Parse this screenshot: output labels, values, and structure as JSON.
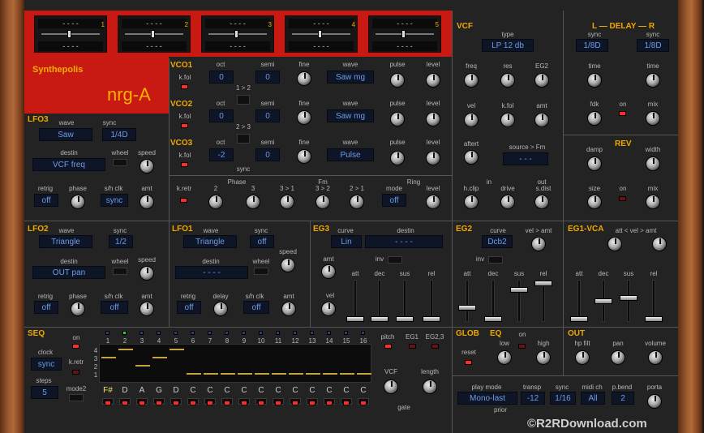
{
  "app": {
    "brand": "Synthepolis",
    "model": "nrg-A"
  },
  "macros": [
    {
      "num": "1",
      "val": "- - - -",
      "val2": "- - - -"
    },
    {
      "num": "2",
      "val": "- - - -",
      "val2": "- - - -"
    },
    {
      "num": "3",
      "val": "- - - -",
      "val2": "- - - -"
    },
    {
      "num": "4",
      "val": "- - - -",
      "val2": "- - - -"
    },
    {
      "num": "5",
      "val": "- - - -",
      "val2": "- - - -"
    }
  ],
  "vco1": {
    "title": "VCO1",
    "kfol": "k.fol",
    "oct_l": "oct",
    "oct": "0",
    "semi_l": "semi",
    "semi": "0",
    "fine": "fine",
    "wave_l": "wave",
    "wave": "Saw mg",
    "pulse": "pulse",
    "level": "level"
  },
  "vco2": {
    "title": "VCO2",
    "kfol": "k.fol",
    "oct_l": "oct",
    "oct": "0",
    "semi_l": "semi",
    "semi": "0",
    "fine": "fine",
    "wave_l": "wave",
    "wave": "Saw mg",
    "pulse": "pulse",
    "level": "level"
  },
  "vco3": {
    "title": "VCO3",
    "kfol": "k.fol",
    "oct_l": "oct",
    "oct": "-2",
    "semi_l": "semi",
    "semi": "0",
    "fine": "fine",
    "wave_l": "wave",
    "wave": "Pulse",
    "pulse": "pulse",
    "level": "level"
  },
  "sync": {
    "s12": "1 > 2",
    "s23": "2 > 3",
    "label": "sync"
  },
  "mix": {
    "kretr": "k.retr",
    "phase": "Phase",
    "p2": "2",
    "p3": "3",
    "fm": "Fm",
    "fm1": "3 > 1",
    "fm2": "3 > 2",
    "fm3": "2 > 1",
    "ring": "Ring",
    "mode_l": "mode",
    "mode": "off",
    "level": "level"
  },
  "vcf": {
    "title": "VCF",
    "type_l": "type",
    "type": "LP 12 db",
    "freq": "freq",
    "res": "res",
    "eg2": "EG2",
    "vel": "vel",
    "kfol": "k.fol",
    "amt": "amt",
    "aftert": "aftert",
    "src_l": "source > Fm",
    "src": "- - -",
    "in": "in",
    "out": "out",
    "hclip": "h.clip",
    "drive": "drive",
    "sdist": "s.dist"
  },
  "delay": {
    "title": "L — DELAY — R",
    "sync_l": "sync",
    "l": "1/8D",
    "r": "1/8D",
    "time": "time",
    "fdk": "fdk",
    "on": "on",
    "mix": "mix"
  },
  "rev": {
    "title": "REV",
    "damp": "damp",
    "width": "width",
    "size": "size",
    "on": "on",
    "mix": "mix"
  },
  "lfo3": {
    "title": "LFO3",
    "wave_l": "wave",
    "wave": "Saw",
    "sync_l": "sync",
    "sync": "1/4D",
    "speed": "speed",
    "destin_l": "destin",
    "destin": "VCF freq",
    "wheel": "wheel",
    "retrig_l": "retrig",
    "retrig": "off",
    "phase": "phase",
    "sh_l": "s/h clk",
    "sh": "sync",
    "amt": "amt"
  },
  "lfo2": {
    "title": "LFO2",
    "wave_l": "wave",
    "wave": "Triangle",
    "sync_l": "sync",
    "sync": "1/2",
    "speed": "speed",
    "destin_l": "destin",
    "destin": "OUT pan",
    "wheel": "wheel",
    "retrig_l": "retrig",
    "retrig": "off",
    "phase": "phase",
    "sh_l": "s/h clk",
    "sh": "off",
    "amt": "amt"
  },
  "lfo1": {
    "title": "LFO1",
    "wave_l": "wave",
    "wave": "Triangle",
    "sync_l": "sync",
    "sync": "off",
    "speed": "speed",
    "destin_l": "destin",
    "destin": "- - - -",
    "wheel": "wheel",
    "retrig_l": "retrig",
    "retrig": "off",
    "delay": "delay",
    "sh_l": "s/h clk",
    "sh": "off",
    "amt": "amt"
  },
  "eg3": {
    "title": "EG3",
    "curve_l": "curve",
    "curve": "Lin",
    "destin_l": "destin",
    "destin": "- - - -",
    "amt": "amt",
    "inv": "inv",
    "vel": "vel",
    "att": "att",
    "dec": "dec",
    "sus": "sus",
    "rel": "rel"
  },
  "eg2": {
    "title": "EG2",
    "curve_l": "curve",
    "curve": "Dcb2",
    "velamt": "vel > amt",
    "inv": "inv",
    "att": "att",
    "dec": "dec",
    "sus": "sus",
    "rel": "rel"
  },
  "eg1": {
    "title": "EG1-VCA",
    "attvel": "att < vel > amt",
    "att": "att",
    "dec": "dec",
    "sus": "sus",
    "rel": "rel"
  },
  "seq": {
    "title": "SEQ",
    "on": "on",
    "clock_l": "clock",
    "clock": "sync",
    "kretr": "k.retr",
    "steps_l": "steps",
    "steps": "5",
    "mode2": "mode2",
    "rows": [
      "4",
      "3",
      "2",
      "1"
    ],
    "nums": [
      "1",
      "2",
      "3",
      "4",
      "5",
      "6",
      "7",
      "8",
      "9",
      "10",
      "11",
      "12",
      "13",
      "14",
      "15",
      "16"
    ],
    "notes": [
      "F#",
      "D",
      "A",
      "G",
      "D",
      "C",
      "C",
      "C",
      "C",
      "C",
      "C",
      "C",
      "C",
      "C",
      "C",
      "C"
    ],
    "levels": [
      0.15,
      0.2,
      0.1,
      0.15,
      0.2,
      0.05,
      0.05,
      0.05,
      0.05,
      0.05,
      0.05,
      0.05,
      0.05,
      0.05,
      0.05,
      0.05
    ],
    "pitch": "pitch",
    "eg1": "EG1",
    "eg23": "EG2,3",
    "vcf": "VCF",
    "length": "length",
    "gate": "gate"
  },
  "glob": {
    "title": "GLOB",
    "reset": "reset"
  },
  "eq": {
    "title": "EQ",
    "on": "on",
    "low": "low",
    "high": "high"
  },
  "out": {
    "title": "OUT",
    "hp": "hp filt",
    "pan": "pan",
    "volume": "volume"
  },
  "play": {
    "mode_l": "play mode",
    "mode": "Mono-last",
    "prior": "prior",
    "transp_l": "transp",
    "transp": "-12",
    "sync_l": "sync",
    "sync": "1/16",
    "midi_l": "midi ch",
    "midi": "All",
    "pbend_l": "p.bend",
    "pbend": "2",
    "porta": "porta"
  },
  "watermark": "©R2RDownload.com"
}
